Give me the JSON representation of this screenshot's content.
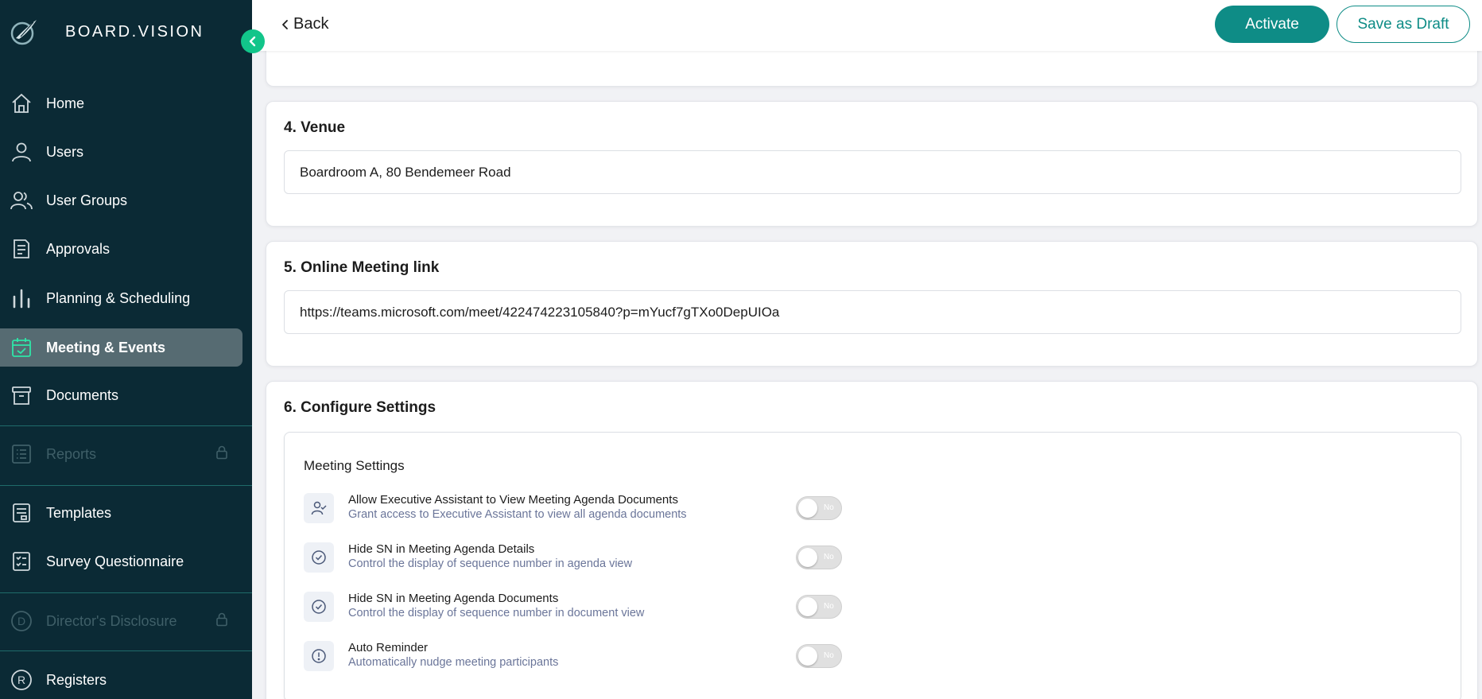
{
  "brand": {
    "name": "BOARD.VISION",
    "logo_icon": "feather-circle-logo"
  },
  "sidebar": {
    "items": [
      {
        "label": "Home",
        "icon": "home-icon"
      },
      {
        "label": "Users",
        "icon": "user-icon"
      },
      {
        "label": "User Groups",
        "icon": "users-icon"
      },
      {
        "label": "Approvals",
        "icon": "document-icon"
      },
      {
        "label": "Planning & Scheduling",
        "icon": "bar-chart-icon"
      },
      {
        "label": "Meeting & Events",
        "icon": "calendar-check-icon",
        "active": true
      },
      {
        "label": "Documents",
        "icon": "archive-icon"
      },
      {
        "label": "Reports",
        "icon": "list-icon",
        "disabled": true
      },
      {
        "label": "Templates",
        "icon": "template-icon"
      },
      {
        "label": "Survey Questionnaire",
        "icon": "checklist-icon"
      },
      {
        "label": "Director's Disclosure",
        "icon": "d-circle-icon",
        "disabled": true
      },
      {
        "label": "Registers",
        "icon": "r-circle-icon"
      }
    ]
  },
  "header": {
    "back_label": "Back",
    "activate_label": "Activate",
    "draft_label": "Save as Draft"
  },
  "venue": {
    "title": "4. Venue",
    "value": "Boardroom A, 80 Bendemeer Road"
  },
  "online_link": {
    "title": "5. Online Meeting link",
    "value": "https://teams.microsoft.com/meet/422474223105840?p=mYucf7gTXo0DepUIOa"
  },
  "configure": {
    "title": "6. Configure Settings",
    "section_label": "Meeting Settings",
    "settings": [
      {
        "title": "Allow Executive Assistant to View Meeting Agenda Documents",
        "desc": "Grant access to Executive Assistant to view all agenda documents",
        "toggle": "No",
        "icon": "user-check-icon"
      },
      {
        "title": "Hide SN in Meeting Agenda Details",
        "desc": "Control the display of sequence number in agenda view",
        "toggle": "No",
        "icon": "check-circle-icon"
      },
      {
        "title": "Hide SN in Meeting Agenda Documents",
        "desc": "Control the display of sequence number in document view",
        "toggle": "No",
        "icon": "check-circle-icon"
      },
      {
        "title": "Auto Reminder",
        "desc": "Automatically nudge meeting participants",
        "toggle": "No",
        "icon": "alert-circle-icon"
      }
    ]
  },
  "colors": {
    "sidebar_bg": "#0b2a35",
    "accent": "#0e8c86",
    "active_nav": "#566b72",
    "collapse_button": "#12c58a"
  }
}
